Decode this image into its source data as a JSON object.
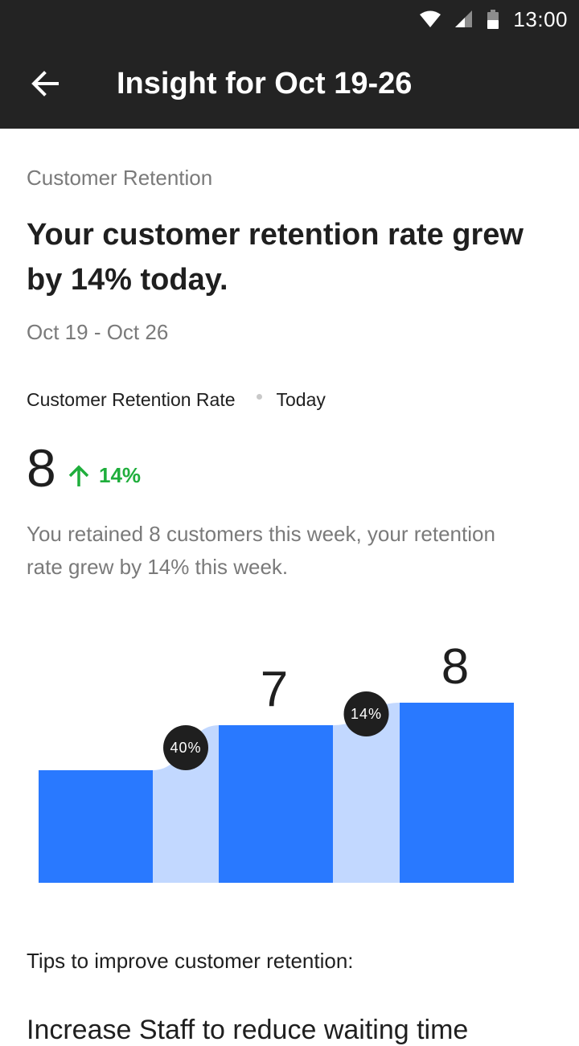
{
  "status_bar": {
    "time": "13:00",
    "icons": [
      "wifi-icon",
      "cell-signal-icon",
      "battery-icon"
    ]
  },
  "app_bar": {
    "title": "Insight for Oct 19-26",
    "back_icon": "arrow-left-icon"
  },
  "insight": {
    "category": "Customer Retention",
    "headline": "Your customer retention rate grew by 14% today.",
    "date_range": "Oct 19 - Oct 26",
    "metric_label": "Customer Retention Rate",
    "metric_period": "Today",
    "value": "8",
    "change": "14%",
    "change_icon": "arrow-up-icon",
    "summary": "You retained 8 customers this week, your retention rate grew by 14% this week."
  },
  "colors": {
    "bar": "#2979ff",
    "connector": "#c2d8ff",
    "positive": "#1fae3c",
    "app_bar": "#232323",
    "badge": "#1f1f1f"
  },
  "chart_data": {
    "type": "bar",
    "values": [
      5,
      7,
      8
    ],
    "value_labels": [
      "",
      "7",
      "8"
    ],
    "changes": [
      "40%",
      "14%"
    ],
    "ylim": [
      0,
      8
    ]
  },
  "tips": {
    "heading": "Tips to improve customer retention:",
    "first_item": "Increase Staff to reduce waiting time"
  }
}
